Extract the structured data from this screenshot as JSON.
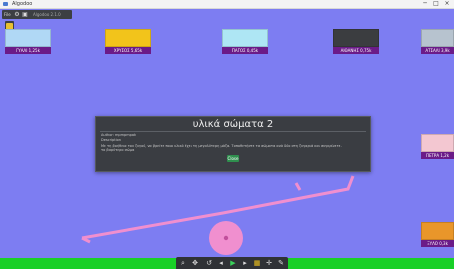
{
  "window": {
    "title": "Algodoo",
    "controls": {
      "minimize": "─",
      "maximize": "□",
      "close": "×"
    }
  },
  "toolbar": {
    "menu_label": "File",
    "version": "Algodoo 2.1.0",
    "buttons": [
      "gear-icon",
      "save-icon"
    ]
  },
  "materials": [
    {
      "label": "ΓΥΑΛΙ 1,25k",
      "color": "#b0d8f5"
    },
    {
      "label": "ΧΡΥΣΟΣ 5,65k",
      "color": "#f2c41b"
    },
    {
      "label": "ΠΑΓΟΣ 0,45k",
      "color": "#aee6f4"
    },
    {
      "label": "ΑΙΘΑΝΗΣ 0,75k",
      "color": "#3b3d40"
    },
    {
      "label": "ΑΤΣΑΛΙ 3,9k",
      "color": "#b7c3cf"
    },
    {
      "label": "ΠΕΤΡΑ 1,2k",
      "color": "#f3c7d1"
    },
    {
      "label": "ΞΥΛΟ 0,3k",
      "color": "#e9962a"
    }
  ],
  "dialog": {
    "title": "υλικά σώματα 2",
    "author": "Author:  mpmpmpak",
    "description_label": "Description",
    "description": "Με τη βοήθεια του ζυγού, να βρείτε ποιο υλικό έχει τη μεγαλύτερη μάζα. Τοποθετήστε τα σώματα ανά δύο στη ζυγαριά και συγκρίνετε.",
    "description_2": "το βαρύτερο σώμα",
    "ok": "Close"
  },
  "bottom_tools": [
    "zoom-icon",
    "move-icon",
    "undo-icon",
    "back-icon",
    "play-icon",
    "forward-icon",
    "grid-icon",
    "snap-icon",
    "pencil-icon"
  ],
  "colors": {
    "canvas": "#7d7df2",
    "ground": "#19d027",
    "seesaw": "#f08fcf",
    "label_bg": "#6b1b88"
  }
}
